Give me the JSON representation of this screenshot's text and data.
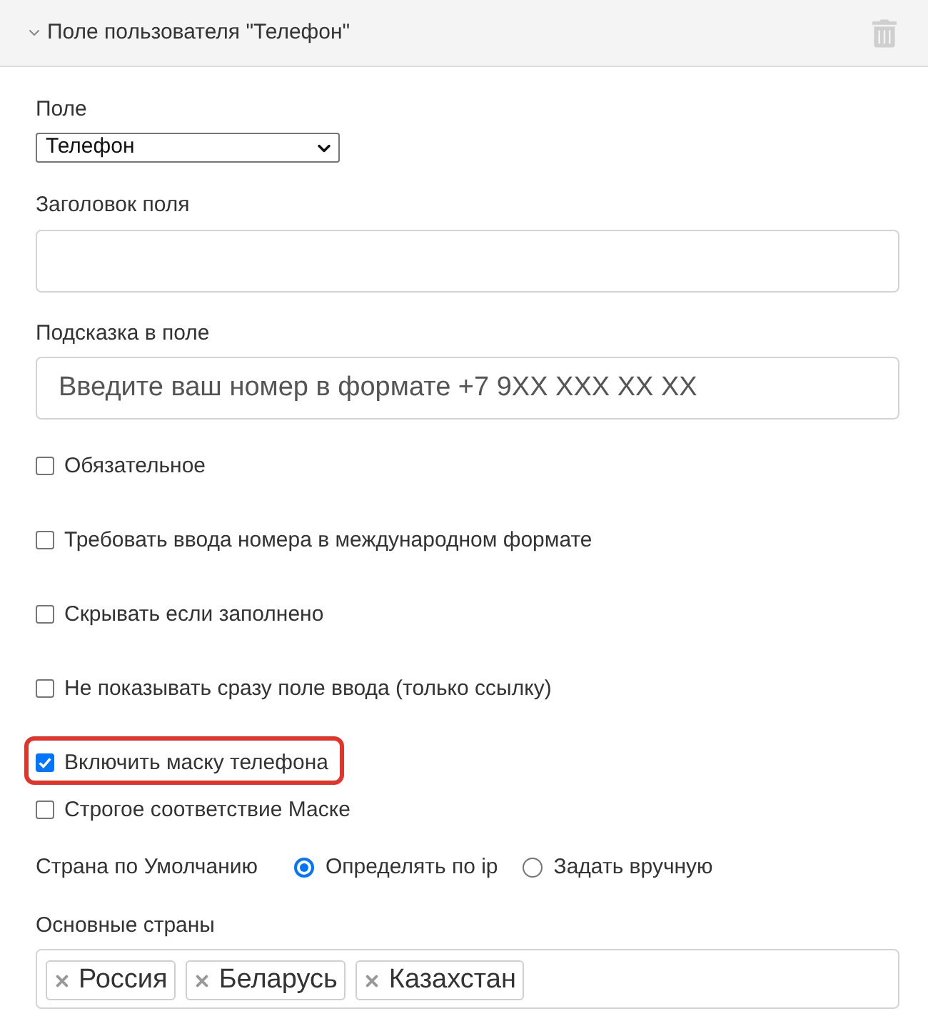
{
  "panel": {
    "title": "Поле пользователя \"Телефон\"",
    "expanded": true
  },
  "field_select": {
    "label": "Поле",
    "value": "Телефон"
  },
  "title_field": {
    "label": "Заголовок поля"
  },
  "hint_field": {
    "label": "Подсказка в поле",
    "value": "Введите ваш номер в формате +7 9XX XXX XX XX"
  },
  "options": [
    {
      "label": "Обязательное",
      "checked": false
    },
    {
      "label": "Требовать ввода номера в международном формате",
      "checked": false
    },
    {
      "label": "Скрывать если заполнено",
      "checked": false
    },
    {
      "label": "Не показывать сразу поле ввода (только ссылку)",
      "checked": false
    }
  ],
  "mask_options": [
    {
      "label": "Включить маску телефона",
      "checked": true,
      "highlighted": true
    },
    {
      "label": "Строгое соответствие Маске",
      "checked": false,
      "highlighted": false
    }
  ],
  "default_country": {
    "label": "Страна по Умолчанию",
    "options": [
      {
        "label": "Определять по ip",
        "selected": true
      },
      {
        "label": "Задать вручную",
        "selected": false
      }
    ]
  },
  "main_countries": {
    "label": "Основные страны",
    "tags": [
      "Россия",
      "Беларусь",
      "Казахстан"
    ]
  }
}
